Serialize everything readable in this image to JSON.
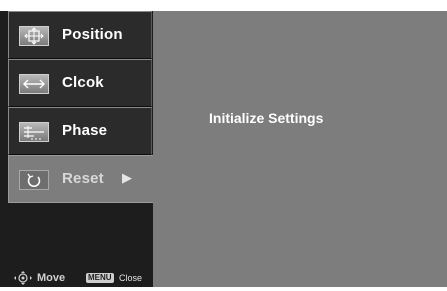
{
  "menu": {
    "items": [
      {
        "label": "Position",
        "icon": "position-icon"
      },
      {
        "label": "Clcok",
        "icon": "clock-icon"
      },
      {
        "label": "Phase",
        "icon": "phase-icon"
      },
      {
        "label": "Reset",
        "icon": "reset-icon",
        "selected": true
      }
    ]
  },
  "footer": {
    "move_label": "Move",
    "menu_key": "MENU",
    "close_label": "Close"
  },
  "content": {
    "title": "Initialize Settings"
  },
  "colors": {
    "panel": "#7d7d7d",
    "sidebar": "#1d1d1d",
    "menu_item": "#2b2b2b",
    "text": "#ffffff"
  }
}
